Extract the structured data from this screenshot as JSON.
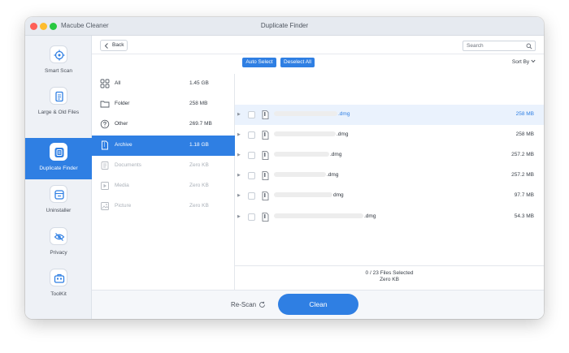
{
  "window": {
    "app_name": "Macube Cleaner",
    "title": "Duplicate Finder"
  },
  "sidebar": {
    "items": [
      {
        "label": "Smart Scan",
        "icon": "target-icon"
      },
      {
        "label": "Large & Old Files",
        "icon": "file-icon"
      },
      {
        "label": "Duplicate Finder",
        "icon": "duplicate-icon",
        "active": true
      },
      {
        "label": "Uninstaller",
        "icon": "uninstaller-icon"
      },
      {
        "label": "Privacy",
        "icon": "eye-slash-icon"
      },
      {
        "label": "ToolKit",
        "icon": "toolkit-icon"
      }
    ]
  },
  "topbar": {
    "back_label": "Back",
    "search_placeholder": "Search"
  },
  "categories": [
    {
      "name": "All",
      "size": "1.45 GB"
    },
    {
      "name": "Folder",
      "size": "258 MB"
    },
    {
      "name": "Other",
      "size": "269.7 MB"
    },
    {
      "name": "Archive",
      "size": "1.18 GB",
      "active": true
    },
    {
      "name": "Documents",
      "size": "Zero KB",
      "disabled": true
    },
    {
      "name": "Media",
      "size": "Zero KB",
      "disabled": true
    },
    {
      "name": "Picture",
      "size": "Zero KB",
      "disabled": true
    }
  ],
  "files_toolbar": {
    "auto_select": "Auto Select",
    "deselect_all": "Deselect All",
    "sort_by": "Sort By"
  },
  "files": [
    {
      "suffix": ".dmg",
      "size": "258 MB"
    },
    {
      "suffix": ".dmg",
      "size": "258 MB"
    },
    {
      "suffix": ".dmg",
      "size": "257.2 MB"
    },
    {
      "suffix": ".dmg",
      "size": "257.2 MB"
    },
    {
      "suffix": "dmg",
      "size": "97.7 MB"
    },
    {
      "suffix": ".dmg",
      "size": "54.3 MB"
    }
  ],
  "status": {
    "selected": "0 / 23 Files Selected",
    "selected_size": "Zero KB"
  },
  "bottom": {
    "rescan": "Re-Scan",
    "clean": "Clean"
  },
  "colors": {
    "accent": "#2f7fe3",
    "sidebar_bg": "#eef1f6"
  }
}
